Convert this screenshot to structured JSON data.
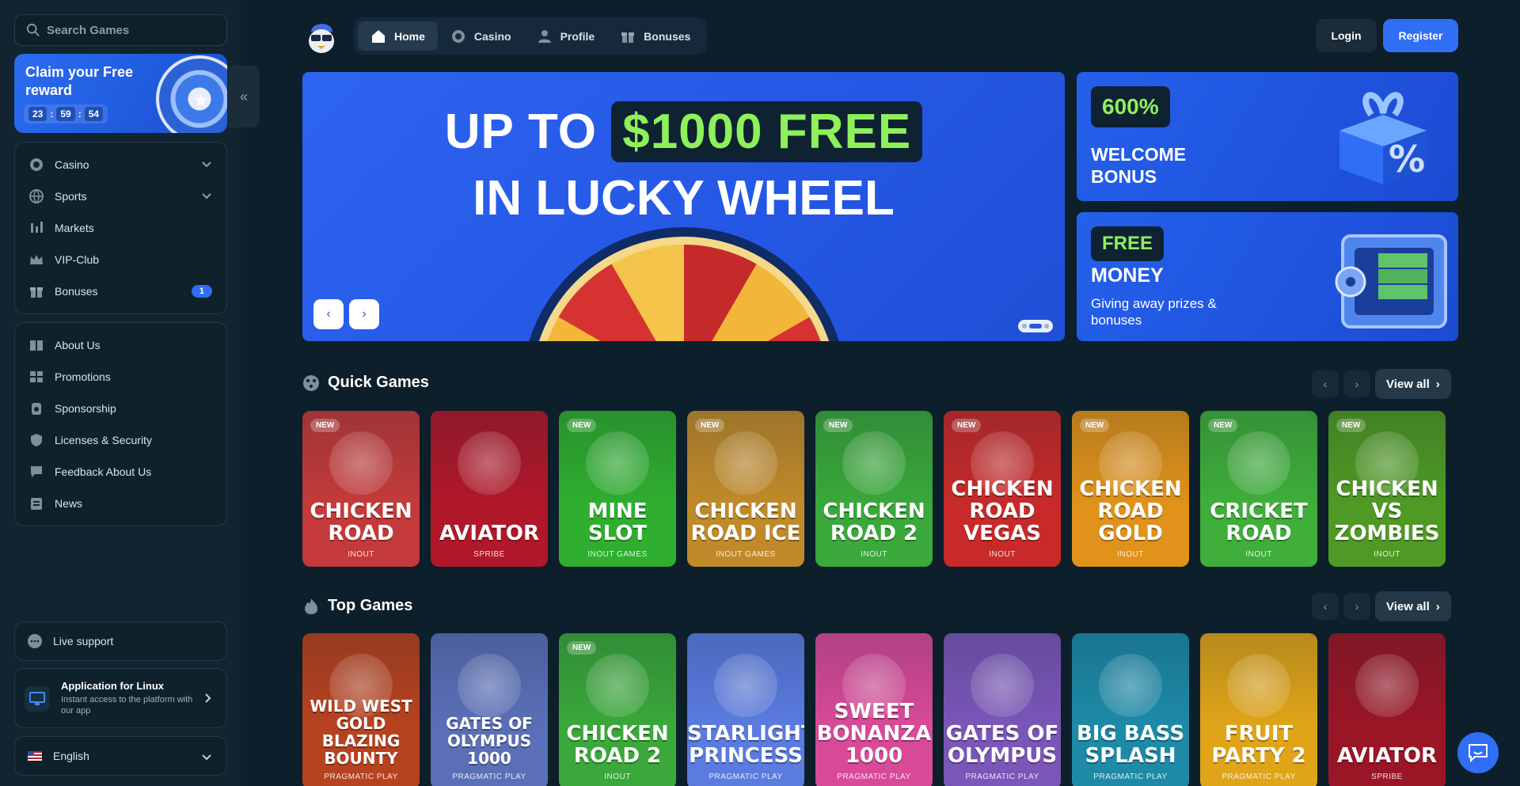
{
  "search": {
    "placeholder": "Search Games"
  },
  "promo": {
    "title": "Claim your Free reward",
    "timer": [
      "23",
      "59",
      "54"
    ]
  },
  "sidebar": {
    "main_items": [
      {
        "label": "Casino",
        "icon": "casino-chip-icon"
      },
      {
        "label": "Sports",
        "icon": "globe-icon"
      },
      {
        "label": "Markets",
        "icon": "markets-icon"
      },
      {
        "label": "VIP-Club",
        "icon": "crown-icon"
      },
      {
        "label": "Bonuses",
        "icon": "gift-icon",
        "badge": "1"
      }
    ],
    "info_items": [
      {
        "label": "About Us",
        "icon": "book-icon"
      },
      {
        "label": "Promotions",
        "icon": "promotions-icon"
      },
      {
        "label": "Sponsorship",
        "icon": "sponsorship-icon"
      },
      {
        "label": "Licenses & Security",
        "icon": "shield-icon"
      },
      {
        "label": "Feedback About Us",
        "icon": "feedback-icon"
      },
      {
        "label": "News",
        "icon": "news-icon"
      }
    ],
    "live_support": "Live support",
    "app": {
      "title": "Application for Linux",
      "subtitle": "Instant access to the platform with our app"
    },
    "language": "English"
  },
  "nav": {
    "items": [
      {
        "label": "Home",
        "icon": "home-icon",
        "active": true
      },
      {
        "label": "Casino",
        "icon": "casino-chip-icon"
      },
      {
        "label": "Profile",
        "icon": "user-icon"
      },
      {
        "label": "Bonuses",
        "icon": "gift-icon"
      }
    ],
    "login": "Login",
    "register": "Register"
  },
  "hero": {
    "line1_prefix": "UP TO",
    "line1_highlight": "$1000 FREE",
    "line2": "IN LUCKY WHEEL"
  },
  "banners": {
    "welcome": {
      "pill": "600%",
      "title": "WELCOME BONUS"
    },
    "money": {
      "pill": "FREE",
      "title": "MONEY",
      "subtitle": "Giving away prizes & bonuses"
    }
  },
  "sections": {
    "view_all": "View all",
    "quick": {
      "title": "Quick Games",
      "games": [
        {
          "name": "CHICKEN ROAD",
          "provider": "INOUT",
          "new": true,
          "bg": "#c43a3a"
        },
        {
          "name": "AVIATOR",
          "provider": "SPRIBE",
          "new": false,
          "bg": "#b0182a"
        },
        {
          "name": "MINE SLOT",
          "provider": "INOUT GAMES",
          "new": true,
          "bg": "#2fae2f"
        },
        {
          "name": "CHICKEN ROAD ICE",
          "provider": "INOUT GAMES",
          "new": true,
          "bg": "#c08a2a"
        },
        {
          "name": "CHICKEN ROAD 2",
          "provider": "INOUT",
          "new": true,
          "bg": "#3aa83a"
        },
        {
          "name": "CHICKEN ROAD VEGAS",
          "provider": "INOUT",
          "new": true,
          "bg": "#c82a2a"
        },
        {
          "name": "CHICKEN ROAD GOLD",
          "provider": "INOUT",
          "new": true,
          "bg": "#e0921a"
        },
        {
          "name": "CRICKET ROAD",
          "provider": "INOUT",
          "new": true,
          "bg": "#3fae3a"
        },
        {
          "name": "CHICKEN VS ZOMBIES",
          "provider": "INOUT",
          "new": true,
          "bg": "#4f9a24"
        }
      ]
    },
    "top": {
      "title": "Top Games",
      "games": [
        {
          "name": "WILD WEST GOLD BLAZING BOUNTY",
          "provider": "PRAGMATIC PLAY",
          "new": false,
          "bg": "#b7421f"
        },
        {
          "name": "GATES OF OLYMPUS 1000",
          "provider": "PRAGMATIC PLAY",
          "new": false,
          "bg": "#5b6fb8"
        },
        {
          "name": "CHICKEN ROAD 2",
          "provider": "INOUT",
          "new": true,
          "bg": "#3aa83a"
        },
        {
          "name": "STARLIGHT PRINCESS",
          "provider": "PRAGMATIC PLAY",
          "new": false,
          "bg": "#5b7be0"
        },
        {
          "name": "SWEET BONANZA 1000",
          "provider": "PRAGMATIC PLAY",
          "new": false,
          "bg": "#d84a98"
        },
        {
          "name": "GATES OF OLYMPUS",
          "provider": "PRAGMATIC PLAY",
          "new": false,
          "bg": "#7a56b8"
        },
        {
          "name": "BIG BASS SPLASH",
          "provider": "PRAGMATIC PLAY",
          "new": false,
          "bg": "#1d8aa8"
        },
        {
          "name": "FRUIT PARTY 2",
          "provider": "PRAGMATIC PLAY",
          "new": false,
          "bg": "#e0a418"
        },
        {
          "name": "AVIATOR",
          "provider": "SPRIBE",
          "new": false,
          "bg": "#9a1626"
        }
      ]
    }
  },
  "colors": {
    "accent": "#2f6ef5",
    "highlight": "#8ef05a",
    "background": "#0d1f2a"
  }
}
